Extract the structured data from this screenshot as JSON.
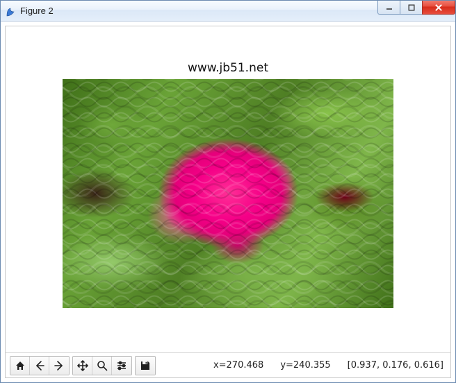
{
  "window": {
    "title": "Figure 2"
  },
  "plot": {
    "title": "www.jb51.net"
  },
  "status": {
    "x_label": "x=270.468",
    "y_label": "y=240.355",
    "rgb": "[0.937, 0.176, 0.616]"
  },
  "toolbar_icons": {
    "home": "home-icon",
    "back": "arrow-left-icon",
    "forward": "arrow-right-icon",
    "pan": "move-icon",
    "zoom": "magnify-icon",
    "configure": "sliders-icon",
    "save": "floppy-icon"
  }
}
